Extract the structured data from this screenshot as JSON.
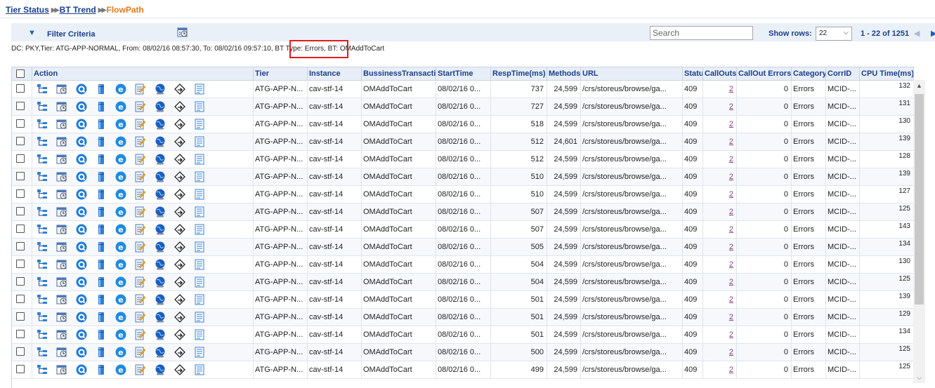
{
  "breadcrumb": {
    "items": [
      "Tier Status",
      "BT Trend"
    ],
    "current": "FlowPath",
    "separator": "▶▶"
  },
  "filter": {
    "toggle_icon": "▼",
    "label": "Filter Criteria",
    "criteria_text": "DC: PKY,Tier: ATG-APP-NORMAL, From: 08/02/16 08:57:30, To: 08/02/16 09:57:10, BT Type: Errors, BT: OMAddToCart"
  },
  "search": {
    "placeholder": "Search",
    "value": ""
  },
  "pager": {
    "show_rows_label": "Show rows:",
    "rows_value": "22",
    "info": "1 - 22 of 1251",
    "prev_icon": "◀",
    "next_icon": "▶"
  },
  "table": {
    "headers": {
      "action": "Action",
      "tier": "Tier",
      "instance": "Instance",
      "bt": "BussinessTransactio",
      "start": "StartTime",
      "resp": "RespTime(ms)",
      "methods": "Methods",
      "url": "URL",
      "status": "Status",
      "callouts": "CallOuts",
      "callout_errors": "CallOut Errors",
      "category": "Category",
      "corrid": "CorrID",
      "cpu": "CPU Time(ms)"
    },
    "action_icons": [
      "flowpath-icon",
      "calendar-icon",
      "query-icon",
      "database-icon",
      "explorer-icon",
      "edit-icon",
      "globe-icon",
      "diamond-arrow-icon",
      "document-icon"
    ],
    "rows": [
      {
        "tier": "ATG-APP-N...",
        "instance": "cav-stf-14",
        "bt": "OMAddToCart",
        "start": "08/02/16 0...",
        "resp": "737",
        "methods": "24,599",
        "url": "/crs/storeus/browse/ga...",
        "status": "409",
        "callouts": "2",
        "callout_errors": "0",
        "category": "Errors",
        "corrid": "MCID-...",
        "cpu": "132"
      },
      {
        "tier": "ATG-APP-N...",
        "instance": "cav-stf-14",
        "bt": "OMAddToCart",
        "start": "08/02/16 0...",
        "resp": "727",
        "methods": "24,599",
        "url": "/crs/storeus/browse/ga...",
        "status": "409",
        "callouts": "2",
        "callout_errors": "0",
        "category": "Errors",
        "corrid": "MCID-...",
        "cpu": "131"
      },
      {
        "tier": "ATG-APP-N...",
        "instance": "cav-stf-14",
        "bt": "OMAddToCart",
        "start": "08/02/16 0...",
        "resp": "518",
        "methods": "24,599",
        "url": "/crs/storeus/browse/ga...",
        "status": "409",
        "callouts": "2",
        "callout_errors": "0",
        "category": "Errors",
        "corrid": "MCID-...",
        "cpu": "130"
      },
      {
        "tier": "ATG-APP-N...",
        "instance": "cav-stf-14",
        "bt": "OMAddToCart",
        "start": "08/02/16 0...",
        "resp": "512",
        "methods": "24,601",
        "url": "/crs/storeus/browse/ga...",
        "status": "409",
        "callouts": "2",
        "callout_errors": "0",
        "category": "Errors",
        "corrid": "MCID-...",
        "cpu": "139"
      },
      {
        "tier": "ATG-APP-N...",
        "instance": "cav-stf-14",
        "bt": "OMAddToCart",
        "start": "08/02/16 0...",
        "resp": "512",
        "methods": "24,599",
        "url": "/crs/storeus/browse/ga...",
        "status": "409",
        "callouts": "2",
        "callout_errors": "0",
        "category": "Errors",
        "corrid": "MCID-...",
        "cpu": "128"
      },
      {
        "tier": "ATG-APP-N...",
        "instance": "cav-stf-14",
        "bt": "OMAddToCart",
        "start": "08/02/16 0...",
        "resp": "510",
        "methods": "24,599",
        "url": "/crs/storeus/browse/ga...",
        "status": "409",
        "callouts": "2",
        "callout_errors": "0",
        "category": "Errors",
        "corrid": "MCID-...",
        "cpu": "139"
      },
      {
        "tier": "ATG-APP-N...",
        "instance": "cav-stf-14",
        "bt": "OMAddToCart",
        "start": "08/02/16 0...",
        "resp": "510",
        "methods": "24,599",
        "url": "/crs/storeus/browse/ga...",
        "status": "409",
        "callouts": "2",
        "callout_errors": "0",
        "category": "Errors",
        "corrid": "MCID-...",
        "cpu": "127"
      },
      {
        "tier": "ATG-APP-N...",
        "instance": "cav-stf-14",
        "bt": "OMAddToCart",
        "start": "08/02/16 0...",
        "resp": "507",
        "methods": "24,599",
        "url": "/crs/storeus/browse/ga...",
        "status": "409",
        "callouts": "2",
        "callout_errors": "0",
        "category": "Errors",
        "corrid": "MCID-...",
        "cpu": "125"
      },
      {
        "tier": "ATG-APP-N...",
        "instance": "cav-stf-14",
        "bt": "OMAddToCart",
        "start": "08/02/16 0...",
        "resp": "507",
        "methods": "24,599",
        "url": "/crs/storeus/browse/ga...",
        "status": "409",
        "callouts": "2",
        "callout_errors": "0",
        "category": "Errors",
        "corrid": "MCID-...",
        "cpu": "143"
      },
      {
        "tier": "ATG-APP-N...",
        "instance": "cav-stf-14",
        "bt": "OMAddToCart",
        "start": "08/02/16 0...",
        "resp": "505",
        "methods": "24,599",
        "url": "/crs/storeus/browse/ga...",
        "status": "409",
        "callouts": "2",
        "callout_errors": "0",
        "category": "Errors",
        "corrid": "MCID-...",
        "cpu": "134"
      },
      {
        "tier": "ATG-APP-N...",
        "instance": "cav-stf-14",
        "bt": "OMAddToCart",
        "start": "08/02/16 0...",
        "resp": "504",
        "methods": "24,599",
        "url": "/crs/storeus/browse/ga...",
        "status": "409",
        "callouts": "2",
        "callout_errors": "0",
        "category": "Errors",
        "corrid": "MCID-...",
        "cpu": "130"
      },
      {
        "tier": "ATG-APP-N...",
        "instance": "cav-stf-14",
        "bt": "OMAddToCart",
        "start": "08/02/16 0...",
        "resp": "504",
        "methods": "24,599",
        "url": "/crs/storeus/browse/ga...",
        "status": "409",
        "callouts": "2",
        "callout_errors": "0",
        "category": "Errors",
        "corrid": "MCID-...",
        "cpu": "125"
      },
      {
        "tier": "ATG-APP-N...",
        "instance": "cav-stf-14",
        "bt": "OMAddToCart",
        "start": "08/02/16 0...",
        "resp": "501",
        "methods": "24,599",
        "url": "/crs/storeus/browse/ga...",
        "status": "409",
        "callouts": "2",
        "callout_errors": "0",
        "category": "Errors",
        "corrid": "MCID-...",
        "cpu": "139"
      },
      {
        "tier": "ATG-APP-N...",
        "instance": "cav-stf-14",
        "bt": "OMAddToCart",
        "start": "08/02/16 0...",
        "resp": "501",
        "methods": "24,599",
        "url": "/crs/storeus/browse/ga...",
        "status": "409",
        "callouts": "2",
        "callout_errors": "0",
        "category": "Errors",
        "corrid": "MCID-...",
        "cpu": "129"
      },
      {
        "tier": "ATG-APP-N...",
        "instance": "cav-stf-14",
        "bt": "OMAddToCart",
        "start": "08/02/16 0...",
        "resp": "501",
        "methods": "24,599",
        "url": "/crs/storeus/browse/ga...",
        "status": "409",
        "callouts": "2",
        "callout_errors": "0",
        "category": "Errors",
        "corrid": "MCID-...",
        "cpu": "134"
      },
      {
        "tier": "ATG-APP-N...",
        "instance": "cav-stf-14",
        "bt": "OMAddToCart",
        "start": "08/02/16 0...",
        "resp": "500",
        "methods": "24,599",
        "url": "/crs/storeus/browse/ga...",
        "status": "409",
        "callouts": "2",
        "callout_errors": "0",
        "category": "Errors",
        "corrid": "MCID-...",
        "cpu": "125"
      },
      {
        "tier": "ATG-APP-N...",
        "instance": "cav-stf-14",
        "bt": "OMAddToCart",
        "start": "08/02/16 0...",
        "resp": "499",
        "methods": "24,599",
        "url": "/crs/storeus/browse/ga...",
        "status": "409",
        "callouts": "2",
        "callout_errors": "0",
        "category": "Errors",
        "corrid": "MCID-...",
        "cpu": "125"
      }
    ]
  },
  "colors": {
    "link": "#1a3f8a",
    "current_crumb": "#e07b1a",
    "highlight": "#e01d1d",
    "callout_link": "#8a3c8a"
  }
}
